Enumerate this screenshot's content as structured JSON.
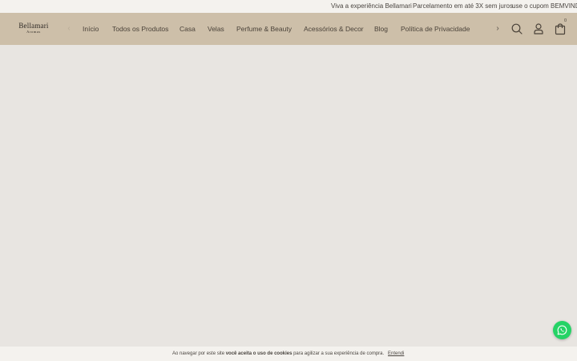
{
  "topbar": {
    "promos": [
      "Viva a experiência Bellamari",
      "Parcelamento em até 3X sem juros",
      "use o cupom BEMVINDO"
    ]
  },
  "header": {
    "logo": {
      "name": "Bellamari",
      "tagline": "Aromas"
    },
    "menu": [
      "Início",
      "Todos os Produtos",
      "Casa",
      "Velas",
      "Perfume & Beauty",
      "Acessórios & Decor",
      "Blog",
      "Política de Privacidade"
    ],
    "cart_count": "0",
    "icons": {
      "prev": "chevron-left-icon",
      "next": "chevron-right-icon",
      "search": "search-icon",
      "account": "user-icon",
      "cart": "shopping-bag-icon"
    }
  },
  "cookie": {
    "text_before": "Ao navegar por este site",
    "text_bold": "você aceita o uso de cookies",
    "text_after": "para agilizar a sua experiência de compra.",
    "accept_label": "Entendi"
  },
  "floating": {
    "whatsapp_icon": "whatsapp-icon"
  },
  "colors": {
    "topbar_bg": "#f4f2ee",
    "nav_bg": "#cdbfa9",
    "page_bg": "#e8e5e1",
    "whatsapp_green": "#25d366"
  }
}
